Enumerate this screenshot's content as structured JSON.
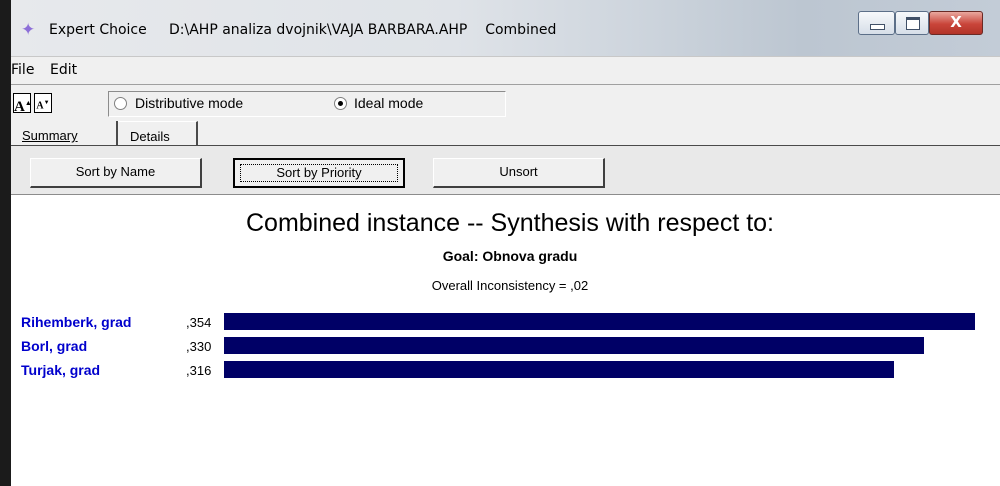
{
  "window": {
    "app_name": "Expert Choice",
    "file_path": "D:\\AHP analiza dvojnik\\VAJA BARBARA.AHP",
    "mode": "Combined",
    "close_label": "X"
  },
  "menu": {
    "file": "File",
    "edit": "Edit"
  },
  "toolbar": {
    "font_up": "A",
    "font_down": "A",
    "distributive_label": "Distributive mode",
    "ideal_label": "Ideal mode",
    "selected_mode": "ideal"
  },
  "tabs": {
    "summary": "Summary",
    "details": "Details"
  },
  "sort": {
    "by_name": "Sort by Name",
    "by_priority": "Sort by Priority",
    "unsort": "Unsort"
  },
  "chart_data": {
    "type": "bar",
    "orientation": "horizontal",
    "title": "Combined instance -- Synthesis with respect to:",
    "subtitle": "Goal: Obnova gradu",
    "inconsistency": "Overall Inconsistency = ,02",
    "categories": [
      "Rihemberk, grad",
      "Borl, grad",
      "Turjak, grad"
    ],
    "value_labels": [
      ",354",
      ",330",
      ",316"
    ],
    "values": [
      0.354,
      0.33,
      0.316
    ],
    "xlim": [
      0,
      0.354
    ],
    "bar_color": "#000066",
    "label_color": "#0000cc"
  }
}
